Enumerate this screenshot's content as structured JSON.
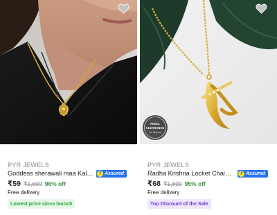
{
  "products": [
    {
      "brand": "PYR JEWELS",
      "title": "Goddess sherawali maa Kali Durga Pendant",
      "assured": "Assured",
      "price": "₹59",
      "mrp": "₹1,699",
      "discount": "96% off",
      "delivery": "Free delivery",
      "tag": "Lowest price since launch",
      "wishlist_icon": "heart-icon"
    },
    {
      "brand": "PYR JEWELS",
      "title": "Radha Krishna Locket Chain Daily Wear",
      "assured": "Assured",
      "price": "₹68",
      "mrp": "₹1,699",
      "discount": "95% off",
      "delivery": "Free delivery",
      "tag": "Top Discount of the Sale",
      "wishlist_icon": "heart-icon",
      "badge": {
        "line1": "FINAL",
        "line2": "CLEARANCE",
        "line3": "No Returns"
      }
    }
  ],
  "colors": {
    "price_green": "#388e3c",
    "assured_blue": "#2874f0",
    "tag_green_bg": "#e7f7e6",
    "tag_purple_bg": "#efe6fb"
  }
}
